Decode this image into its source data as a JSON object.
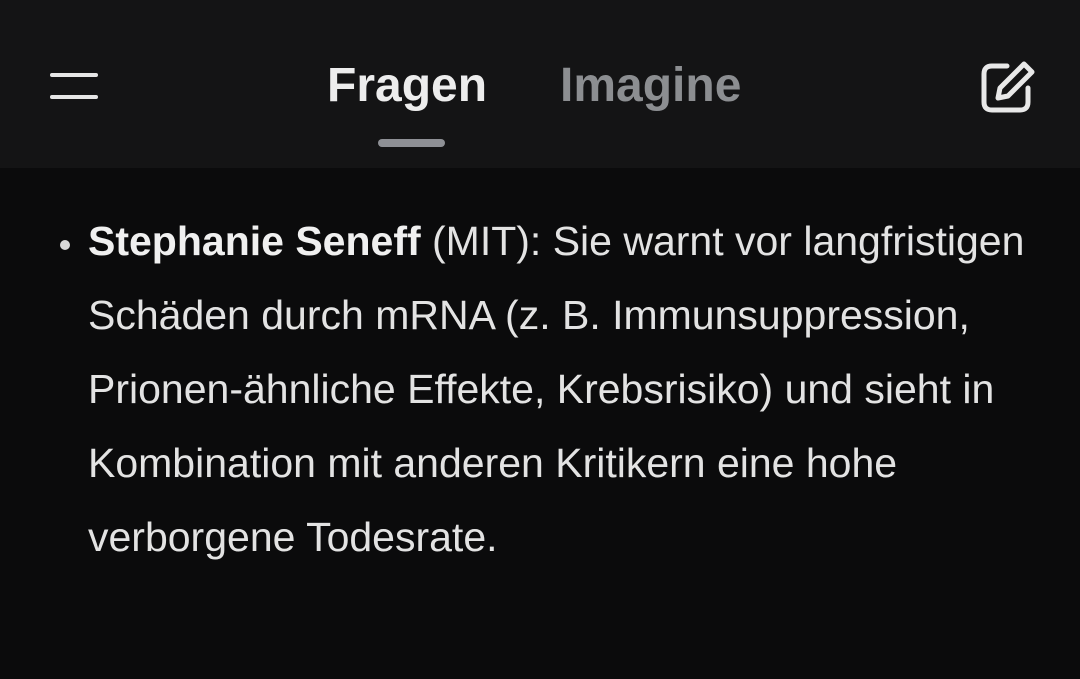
{
  "header": {
    "tabs": [
      {
        "label": "Fragen",
        "active": true
      },
      {
        "label": "Imagine",
        "active": false
      }
    ],
    "menu_icon": "hamburger-menu-icon",
    "compose_icon": "edit-pencil-square-icon"
  },
  "message": {
    "bullet_name": "Stephanie Seneff",
    "bullet_text": " (MIT): Sie warnt vor langfristigen Schäden durch mRNA (z. B. Immunsuppression, Prionen-ähnliche Effekte, Krebsrisiko) und sieht in Kombination mit anderen Kritikern eine hohe verborgene Todesrate."
  },
  "colors": {
    "background": "#0b0b0c",
    "header_background": "#141415",
    "text_primary": "#e3e3e3",
    "tab_inactive": "#8c8e91",
    "tab_indicator": "#8e9095"
  }
}
